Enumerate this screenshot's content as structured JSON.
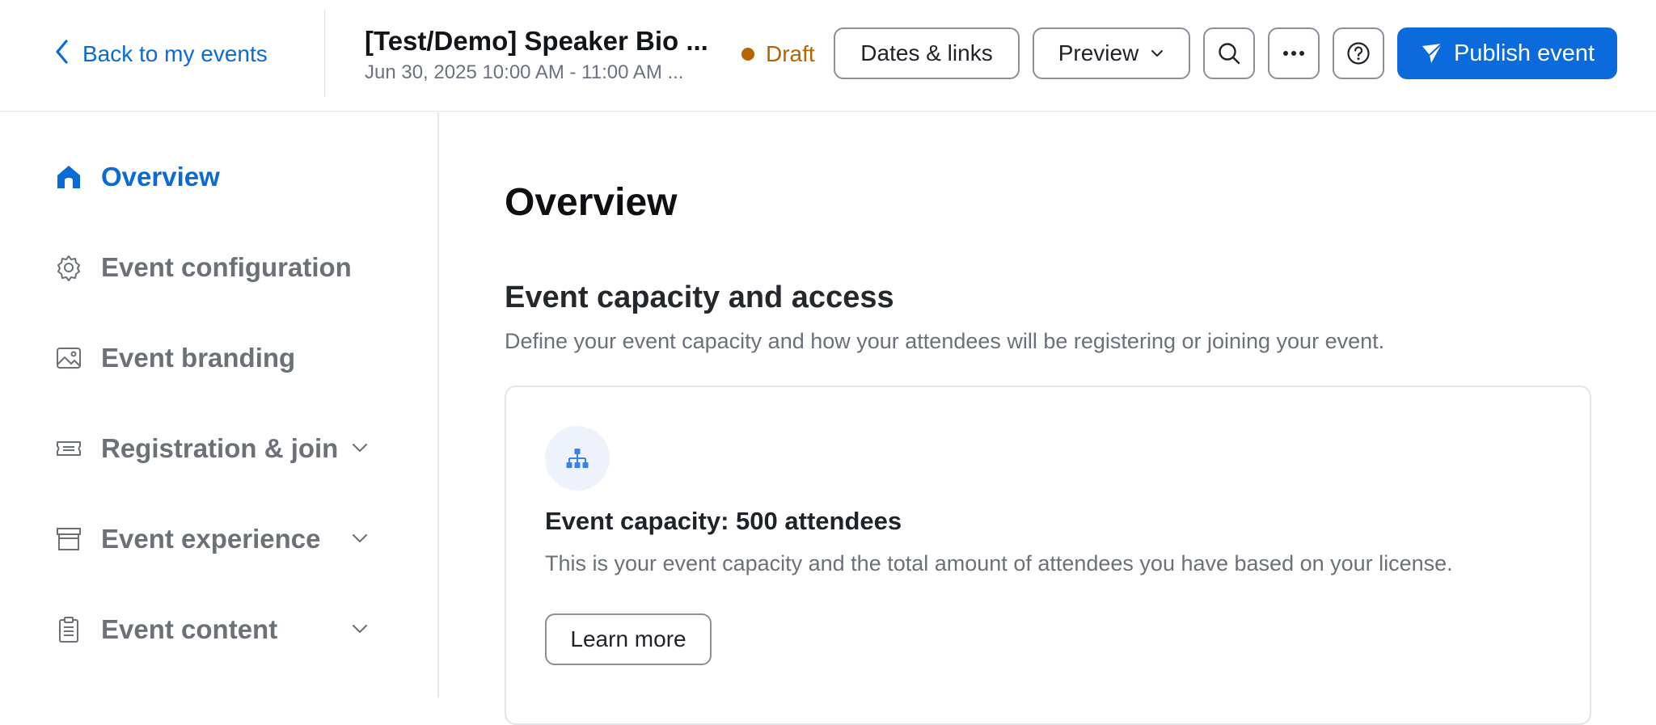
{
  "header": {
    "back_label": "Back to my events",
    "event_title": "[Test/Demo] Speaker Bio ...",
    "event_dates": "Jun 30, 2025 10:00 AM - 11:00 AM ...",
    "status_label": "Draft",
    "status_color": "#b86400",
    "dates_links_label": "Dates & links",
    "preview_label": "Preview",
    "publish_label": "Publish event",
    "accent_color": "#0b6bdc",
    "icons": [
      "chevron-left-icon",
      "chevron-down-icon",
      "search-icon",
      "more-icon",
      "help-icon",
      "send-icon"
    ]
  },
  "sidebar": {
    "items": [
      {
        "label": "Overview",
        "icon": "home-icon",
        "active": true
      },
      {
        "label": "Event configuration",
        "icon": "gear-icon"
      },
      {
        "label": "Event branding",
        "icon": "image-icon"
      },
      {
        "label": "Registration & join",
        "icon": "ticket-icon",
        "expandable": true
      },
      {
        "label": "Event experience",
        "icon": "archive-icon",
        "expandable": true
      },
      {
        "label": "Event content",
        "icon": "clipboard-icon",
        "expandable": true
      }
    ]
  },
  "main": {
    "page_title": "Overview",
    "section_title": "Event capacity and access",
    "section_desc": "Define your event capacity and how your attendees will be registering or joining your event.",
    "card": {
      "icon": "hierarchy-icon",
      "title": "Event capacity: 500 attendees",
      "desc": "This is your event capacity and the total amount of attendees you have based on your license.",
      "button_label": "Learn more"
    }
  }
}
